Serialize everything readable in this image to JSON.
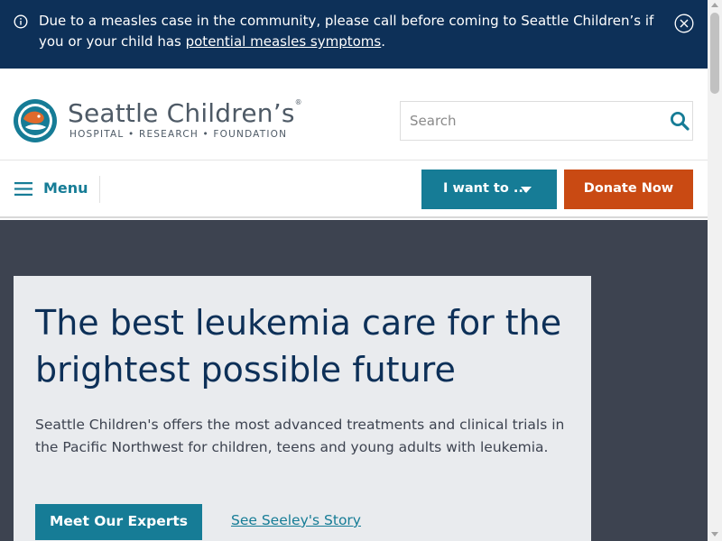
{
  "alert": {
    "message": "Due to a measles case in the community, please call before coming to Seattle Children’s if you or your child has ",
    "link_text": "potential measles symptoms",
    "message_end": ".",
    "icon": "info-icon",
    "close_icon": "close-icon"
  },
  "header": {
    "logo_name": "Seattle Children’s",
    "logo_reg": "®",
    "logo_tagline": "HOSPITAL • RESEARCH • FOUNDATION",
    "search": {
      "placeholder": "Search",
      "value": "",
      "icon": "search-icon"
    }
  },
  "nav": {
    "menu_label": "Menu",
    "i_want_label": "I want to ...",
    "donate_label": "Donate Now"
  },
  "hero": {
    "title": "The best leukemia care for the brightest possible future",
    "body": "Seattle Children's offers the most advanced treatments and clinical trials in the Pacific Northwest for children, teens and young adults with leukemia.",
    "primary_button": "Meet Our Experts",
    "secondary_link": "See Seeley's Story"
  },
  "colors": {
    "alert_bg": "#0d3058",
    "teal": "#167c96",
    "donate": "#c94a13",
    "hero_bg": "#3d4350",
    "card_bg": "#e9ebee",
    "logo_orange": "#e06a2b"
  }
}
